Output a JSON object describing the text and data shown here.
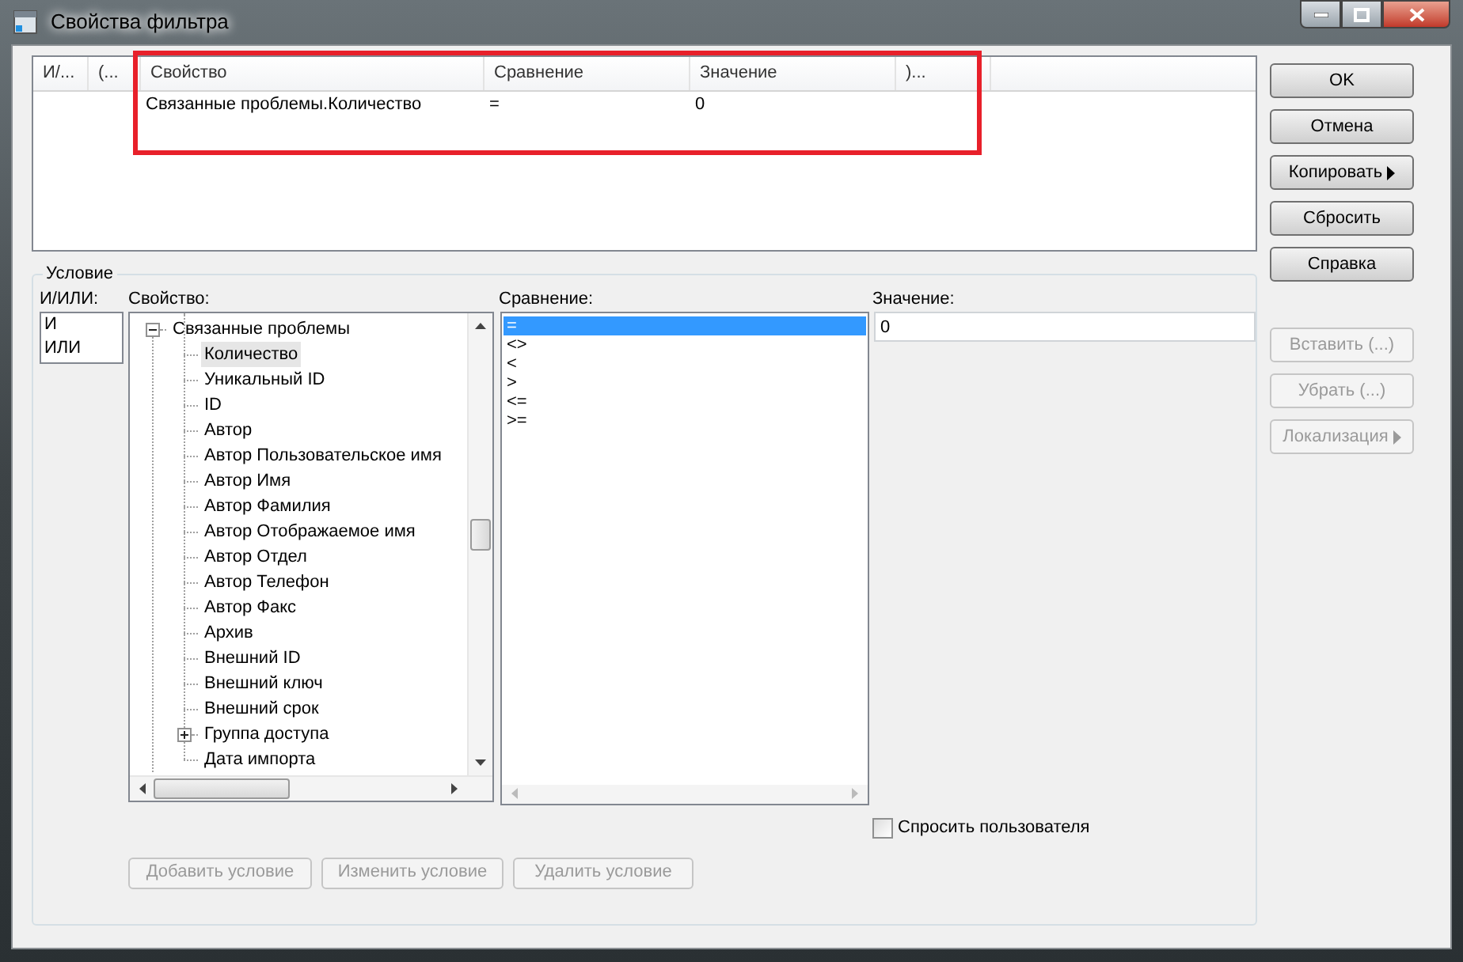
{
  "window": {
    "title": "Свойства фильтра"
  },
  "filter_table": {
    "columns": [
      "И/...",
      "(...",
      "Свойство",
      "Сравнение",
      "Значение",
      ")..."
    ],
    "rows": [
      [
        "",
        "",
        "Связанные проблемы.Количество",
        "=",
        "0",
        ""
      ]
    ]
  },
  "side_buttons": [
    {
      "label": "OK",
      "disabled": false,
      "arrow": false
    },
    {
      "label": "Отмена",
      "disabled": false,
      "arrow": false
    },
    {
      "label": "Копировать",
      "disabled": false,
      "arrow": true
    },
    {
      "label": "Сбросить",
      "disabled": false,
      "arrow": false
    },
    {
      "label": "Справка",
      "disabled": false,
      "arrow": false
    },
    {
      "label": "Вставить (...)",
      "disabled": true,
      "arrow": false
    },
    {
      "label": "Убрать (...)",
      "disabled": true,
      "arrow": false
    },
    {
      "label": "Локализация",
      "disabled": true,
      "arrow": true
    }
  ],
  "condition": {
    "title": "Условие",
    "andor_label": "И/ИЛИ:",
    "andor_items": [
      {
        "label": "И",
        "selected": false
      },
      {
        "label": "ИЛИ",
        "selected": false
      }
    ],
    "property_label": "Свойство:",
    "property_tree": [
      {
        "label": "Связанные проблемы",
        "expanded": true,
        "selected": false,
        "children": [
          {
            "label": "Количество",
            "selected": true
          },
          {
            "label": "Уникальный ID",
            "selected": false
          },
          {
            "label": "ID",
            "selected": false
          },
          {
            "label": "Автор",
            "selected": false
          },
          {
            "label": "Автор Пользовательское имя",
            "selected": false
          },
          {
            "label": "Автор Имя",
            "selected": false
          },
          {
            "label": "Автор Фамилия",
            "selected": false
          },
          {
            "label": "Автор Отображаемое имя",
            "selected": false
          },
          {
            "label": "Автор Отдел",
            "selected": false
          },
          {
            "label": "Автор Телефон",
            "selected": false
          },
          {
            "label": "Автор Факс",
            "selected": false
          },
          {
            "label": "Архив",
            "selected": false
          },
          {
            "label": "Внешний ID",
            "selected": false
          },
          {
            "label": "Внешний ключ",
            "selected": false
          },
          {
            "label": "Внешний срок",
            "selected": false
          },
          {
            "label": "Группа доступа",
            "expanded": false,
            "selected": false
          },
          {
            "label": "Дата импорта",
            "selected": false
          }
        ]
      }
    ],
    "comparison_label": "Сравнение:",
    "comparison_items": [
      {
        "label": "=",
        "selected": true
      },
      {
        "label": "<>",
        "selected": false
      },
      {
        "label": "<",
        "selected": false
      },
      {
        "label": ">",
        "selected": false
      },
      {
        "label": "<=",
        "selected": false
      },
      {
        "label": ">=",
        "selected": false
      }
    ],
    "value_label": "Значение:",
    "value": "0",
    "ask_user": {
      "label": "Спросить пользователя",
      "checked": false
    },
    "buttons": [
      {
        "label": "Добавить условие",
        "disabled": true
      },
      {
        "label": "Изменить условие",
        "disabled": true
      },
      {
        "label": "Удалить условие",
        "disabled": true
      }
    ]
  }
}
